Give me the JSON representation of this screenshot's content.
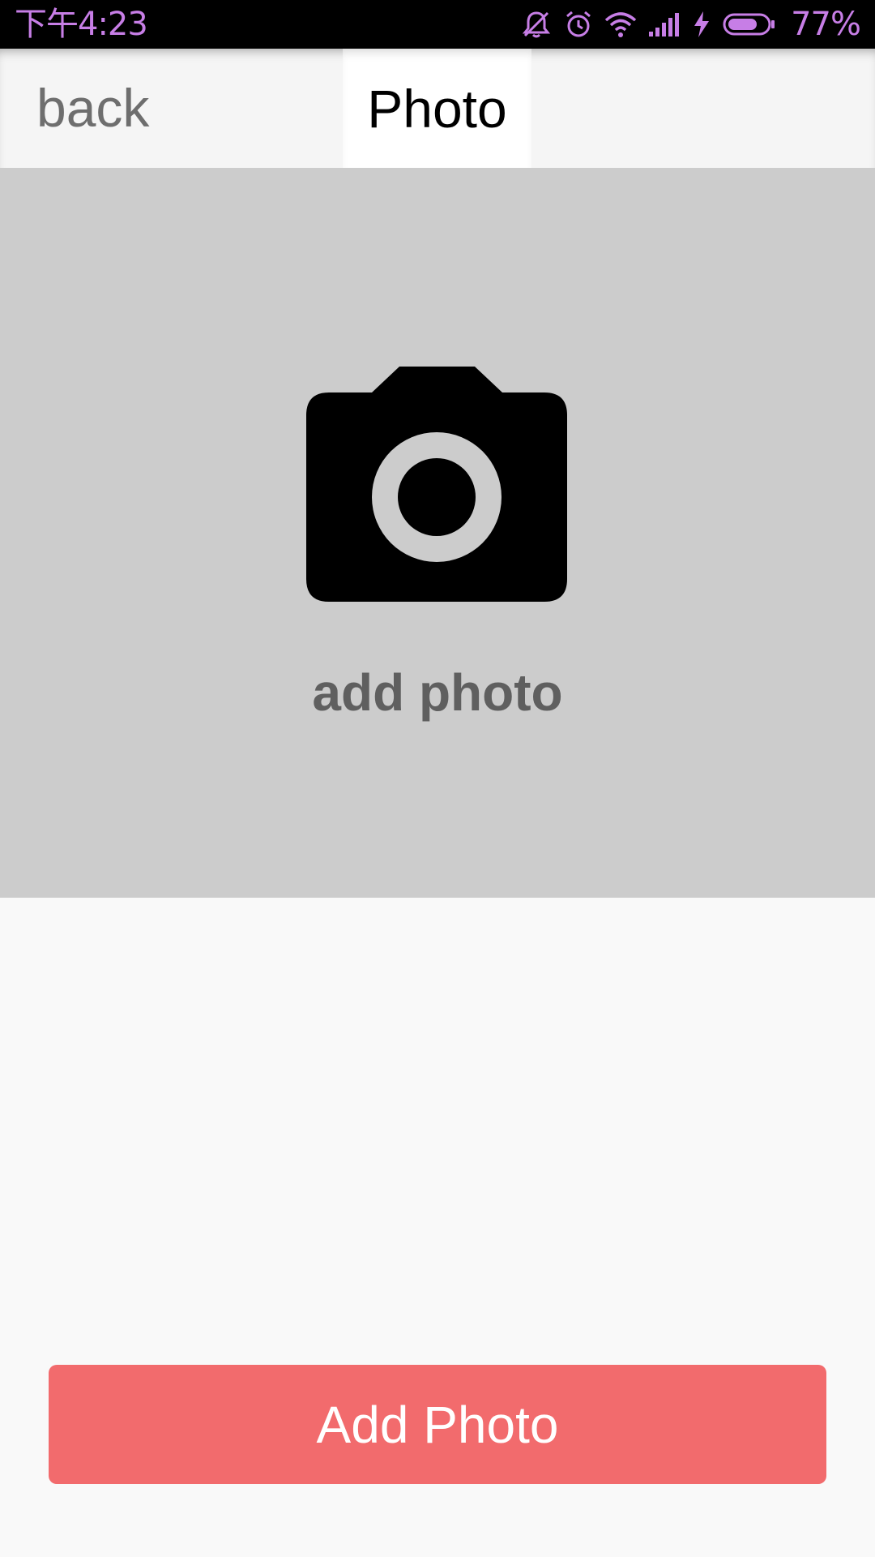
{
  "status_bar": {
    "time": "下午4:23",
    "battery_percent": "77%",
    "icons": [
      "mute-icon",
      "alarm-icon",
      "wifi-icon",
      "signal-icon",
      "charging-icon",
      "battery-icon"
    ],
    "battery_level": 0.77,
    "accent_color": "#c77ee6"
  },
  "header": {
    "back_label": "back",
    "title": "Photo"
  },
  "photo_area": {
    "icon": "camera-icon",
    "caption": "add photo",
    "background_color": "#cccccc"
  },
  "actions": {
    "add_photo_label": "Add Photo",
    "button_color": "#f26b6d"
  }
}
